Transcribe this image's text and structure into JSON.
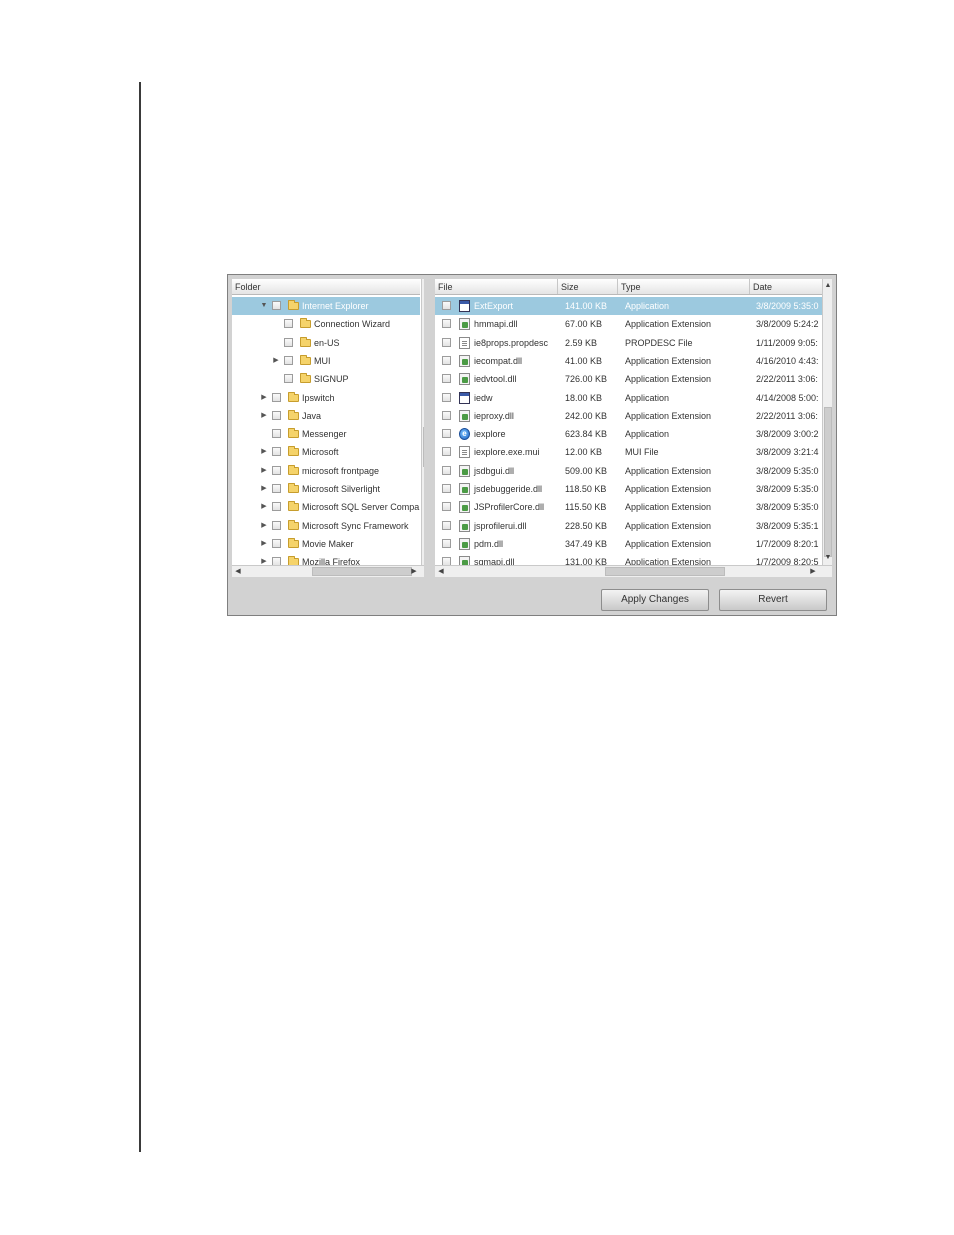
{
  "headers": {
    "folder": "Folder",
    "file": "File",
    "size": "Size",
    "type": "Type",
    "date": "Date"
  },
  "folders": [
    {
      "label": "Internet Explorer",
      "level": 0,
      "expander": "▼",
      "selected": true
    },
    {
      "label": "Connection Wizard",
      "level": 1,
      "expander": ""
    },
    {
      "label": "en-US",
      "level": 1,
      "expander": ""
    },
    {
      "label": "MUI",
      "level": 1,
      "expander": "▶"
    },
    {
      "label": "SIGNUP",
      "level": 1,
      "expander": ""
    },
    {
      "label": "Ipswitch",
      "level": 0,
      "expander": "▶"
    },
    {
      "label": "Java",
      "level": 0,
      "expander": "▶"
    },
    {
      "label": "Messenger",
      "level": 0,
      "expander": ""
    },
    {
      "label": "Microsoft",
      "level": 0,
      "expander": "▶"
    },
    {
      "label": "microsoft frontpage",
      "level": 0,
      "expander": "▶"
    },
    {
      "label": "Microsoft Silverlight",
      "level": 0,
      "expander": "▶"
    },
    {
      "label": "Microsoft SQL Server Compa",
      "level": 0,
      "expander": "▶"
    },
    {
      "label": "Microsoft Sync Framework",
      "level": 0,
      "expander": "▶"
    },
    {
      "label": "Movie Maker",
      "level": 0,
      "expander": "▶"
    },
    {
      "label": "Mozilla Firefox",
      "level": 0,
      "expander": "▶"
    }
  ],
  "files": [
    {
      "name": "ExtExport",
      "icon": "application-icon",
      "size": "141.00 KB",
      "type": "Application",
      "date": "3/8/2009 5:35:0",
      "selected": true
    },
    {
      "name": "hmmapi.dll",
      "icon": "dll-icon",
      "size": "67.00 KB",
      "type": "Application Extension",
      "date": "3/8/2009 5:24:2"
    },
    {
      "name": "ie8props.propdesc",
      "icon": "document-icon",
      "size": "2.59 KB",
      "type": "PROPDESC File",
      "date": "1/11/2009 9:05:"
    },
    {
      "name": "iecompat.dll",
      "icon": "dll-icon",
      "size": "41.00 KB",
      "type": "Application Extension",
      "date": "4/16/2010 4:43:"
    },
    {
      "name": "iedvtool.dll",
      "icon": "dll-icon",
      "size": "726.00 KB",
      "type": "Application Extension",
      "date": "2/22/2011 3:06:"
    },
    {
      "name": "iedw",
      "icon": "application-icon",
      "size": "18.00 KB",
      "type": "Application",
      "date": "4/14/2008 5:00:"
    },
    {
      "name": "ieproxy.dll",
      "icon": "dll-icon",
      "size": "242.00 KB",
      "type": "Application Extension",
      "date": "2/22/2011 3:06:"
    },
    {
      "name": "iexplore",
      "icon": "internet-explorer-icon",
      "size": "623.84 KB",
      "type": "Application",
      "date": "3/8/2009 3:00:2"
    },
    {
      "name": "iexplore.exe.mui",
      "icon": "document-icon",
      "size": "12.00 KB",
      "type": "MUI File",
      "date": "3/8/2009 3:21:4"
    },
    {
      "name": "jsdbgui.dll",
      "icon": "dll-icon",
      "size": "509.00 KB",
      "type": "Application Extension",
      "date": "3/8/2009 5:35:0"
    },
    {
      "name": "jsdebuggeride.dll",
      "icon": "dll-icon",
      "size": "118.50 KB",
      "type": "Application Extension",
      "date": "3/8/2009 5:35:0"
    },
    {
      "name": "JSProfilerCore.dll",
      "icon": "dll-icon",
      "size": "115.50 KB",
      "type": "Application Extension",
      "date": "3/8/2009 5:35:0"
    },
    {
      "name": "jsprofilerui.dll",
      "icon": "dll-icon",
      "size": "228.50 KB",
      "type": "Application Extension",
      "date": "3/8/2009 5:35:1"
    },
    {
      "name": "pdm.dll",
      "icon": "dll-icon",
      "size": "347.49 KB",
      "type": "Application Extension",
      "date": "1/7/2009 8:20:1"
    },
    {
      "name": "sqmapi.dll",
      "icon": "dll-icon",
      "size": "131.00 KB",
      "type": "Application Extension",
      "date": "1/7/2009 8:20:5"
    }
  ],
  "buttons": {
    "apply": "Apply Changes",
    "revert": "Revert"
  },
  "colors": {
    "selection": "#9cc9df",
    "panel_background": "#d2d2d2"
  }
}
